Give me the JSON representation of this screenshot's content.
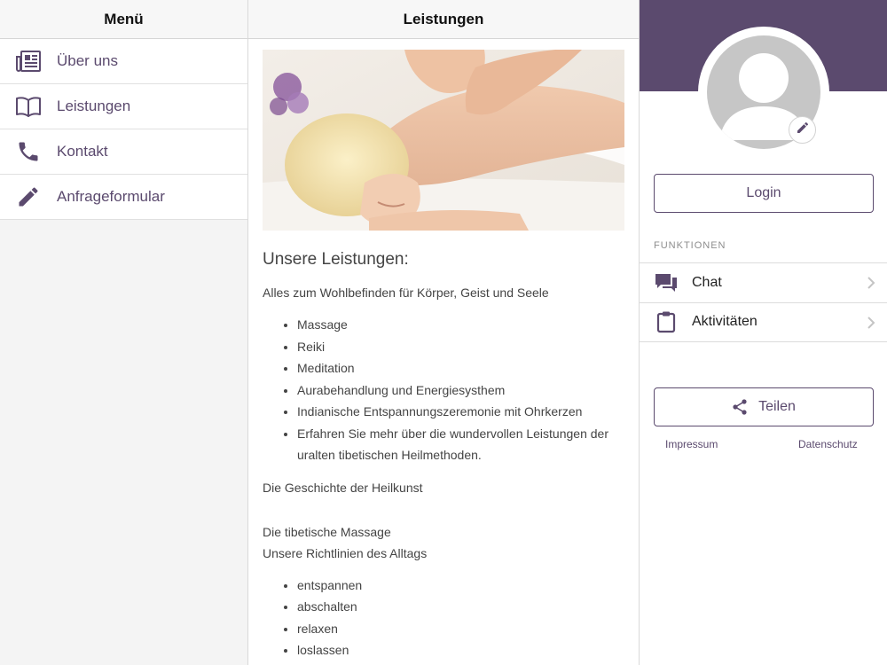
{
  "left_panel": {
    "title": "Menü",
    "items": [
      {
        "label": "Über uns",
        "icon": "newspaper-icon"
      },
      {
        "label": "Leistungen",
        "icon": "book-icon"
      },
      {
        "label": "Kontakt",
        "icon": "phone-icon"
      },
      {
        "label": "Anfrageformular",
        "icon": "pencil-icon"
      }
    ]
  },
  "center": {
    "title": "Leistungen",
    "hero_image": "massage-photo",
    "heading": "Unsere Leistungen:",
    "intro": "Alles zum Wohlbefinden für Körper, Geist und Seele",
    "services": [
      "Massage",
      "Reiki",
      "Meditation",
      "Aurabehandlung und Energiesysthem",
      "Indianische Entspannungszeremonie mit Ohrkerzen",
      "Erfahren Sie mehr über die wundervollen Leistungen der uralten tibetischen Heilmethoden."
    ],
    "history": "Die Geschichte der Heilkunst",
    "massage_title": "Die tibetische Massage",
    "guidelines_title": "Unsere Richtlinien des Alltags",
    "guidelines": [
      "entspannen",
      "abschalten",
      "relaxen",
      "loslassen"
    ]
  },
  "right_panel": {
    "login_label": "Login",
    "functions_label": "FUNKTIONEN",
    "functions": [
      {
        "label": "Chat",
        "icon": "chat-icon"
      },
      {
        "label": "Aktivitäten",
        "icon": "clipboard-icon"
      }
    ],
    "share_label": "Teilen",
    "impressum_label": "Impressum",
    "datenschutz_label": "Datenschutz"
  },
  "colors": {
    "accent": "#5b4a6e",
    "avatar_gray": "#c6c6c6",
    "panel_bg": "#f4f4f4"
  }
}
